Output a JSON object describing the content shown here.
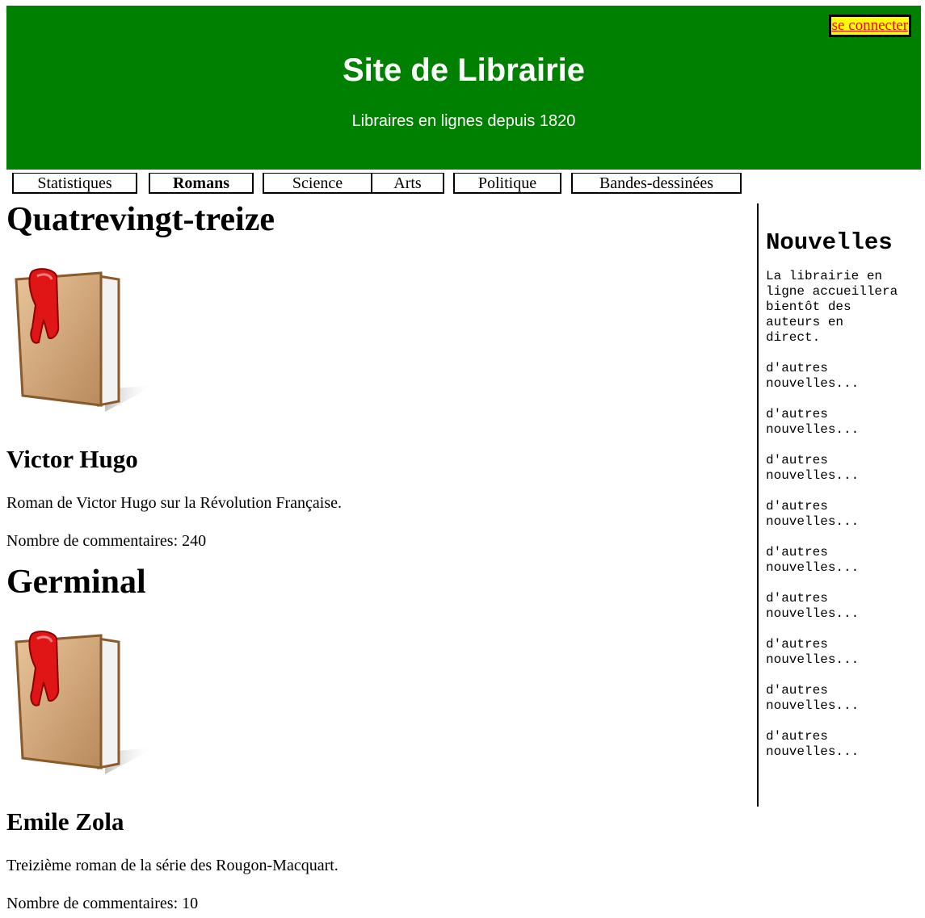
{
  "header": {
    "title": "Site de Librairie",
    "subtitle": "Libraires en lignes depuis 1820",
    "login_label": "se connecter",
    "bg_color": "#008000"
  },
  "nav": {
    "tabs": [
      {
        "label": "Statistiques",
        "active": false
      },
      {
        "label": "Romans",
        "active": true
      },
      {
        "label": "Science",
        "active": false
      },
      {
        "label": "Arts",
        "active": false
      },
      {
        "label": "Politique",
        "active": false
      },
      {
        "label": "Bandes-dessinées",
        "active": false
      }
    ]
  },
  "books": [
    {
      "title": "Quatrevingt-treize",
      "author": "Victor Hugo",
      "description": "Roman de Victor Hugo sur la Révolution Française.",
      "comments": "Nombre de commentaires: 240",
      "icon": "book-icon"
    },
    {
      "title": "Germinal",
      "author": "Emile Zola",
      "description": "Treizième roman de la série des Rougon-Macquart.",
      "comments": "Nombre de commentaires: 10",
      "icon": "book-icon"
    }
  ],
  "sidebar": {
    "title": "Nouvelles",
    "news": [
      "La librairie en ligne accueillera bientôt des auteurs en direct.",
      "d'autres nouvelles...",
      "d'autres nouvelles...",
      "d'autres nouvelles...",
      "d'autres nouvelles...",
      "d'autres nouvelles...",
      "d'autres nouvelles...",
      "d'autres nouvelles...",
      "d'autres nouvelles...",
      "d'autres nouvelles..."
    ]
  }
}
